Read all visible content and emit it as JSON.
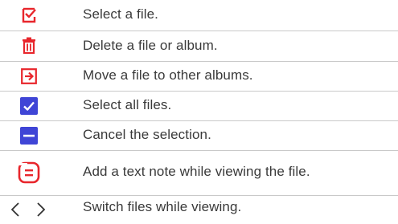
{
  "colors": {
    "accent_red": "#e8262c",
    "accent_blue": "#3f45d6",
    "divider": "#c9c9c9",
    "text": "#3a3a3a"
  },
  "rows": [
    {
      "icon": "select-file-icon",
      "label": "Select a file."
    },
    {
      "icon": "trash-icon",
      "label": "Delete a file or album."
    },
    {
      "icon": "move-arrow-icon",
      "label": "Move a file to other albums."
    },
    {
      "icon": "check-all-icon",
      "label": "Select all files."
    },
    {
      "icon": "cancel-selection-icon",
      "label": "Cancel the selection."
    },
    {
      "icon": "text-note-icon",
      "label": "Add a text note while viewing the file."
    },
    {
      "icon": "prev-next-icon",
      "label": "Switch files while viewing."
    }
  ]
}
